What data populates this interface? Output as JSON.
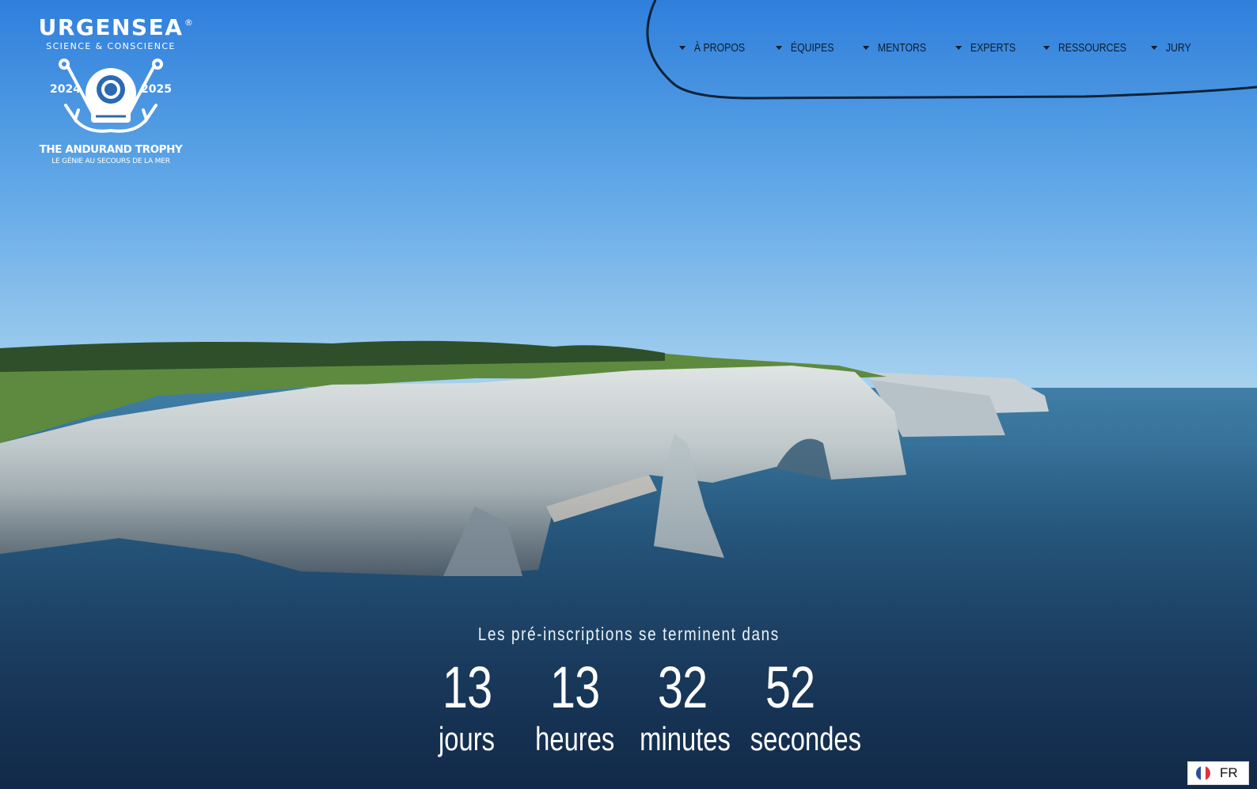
{
  "logo": {
    "brand": "URGENSEA",
    "registered": "®",
    "tagline": "SCIENCE & CONSCIENCE",
    "year_left": "2024",
    "year_right": "2025",
    "trophy_title": "THE ANDURAND TROPHY",
    "trophy_subtitle": "LE GÉNIE AU SECOURS DE LA MER",
    "emblem_icon": "diving-helmet-anchors-icon"
  },
  "nav": {
    "items": [
      {
        "label": "À PROPOS",
        "icon": "caret-down-icon"
      },
      {
        "label": "ÉQUIPES",
        "icon": "caret-down-icon"
      },
      {
        "label": "MENTORS",
        "icon": "caret-down-icon"
      },
      {
        "label": "EXPERTS",
        "icon": "caret-down-icon"
      },
      {
        "label": "RESSOURCES",
        "icon": "caret-down-icon"
      },
      {
        "label": "JURY",
        "icon": "caret-down-icon"
      }
    ]
  },
  "countdown": {
    "heading": "Les pré-inscriptions se terminent dans",
    "units": [
      {
        "value": "13",
        "label": "jours"
      },
      {
        "value": "13",
        "label": "heures"
      },
      {
        "value": "32",
        "label": "minutes"
      },
      {
        "value": "52",
        "label": "secondes"
      }
    ]
  },
  "language": {
    "code": "FR",
    "flag_icon": "france-flag-icon",
    "flag_colors": [
      "#2a4fa0",
      "#ffffff",
      "#e0323c"
    ]
  },
  "colors": {
    "nav_text": "#0e1d2e",
    "sky_top": "#2f7fdc",
    "sea_deep": "#1c3d63"
  }
}
